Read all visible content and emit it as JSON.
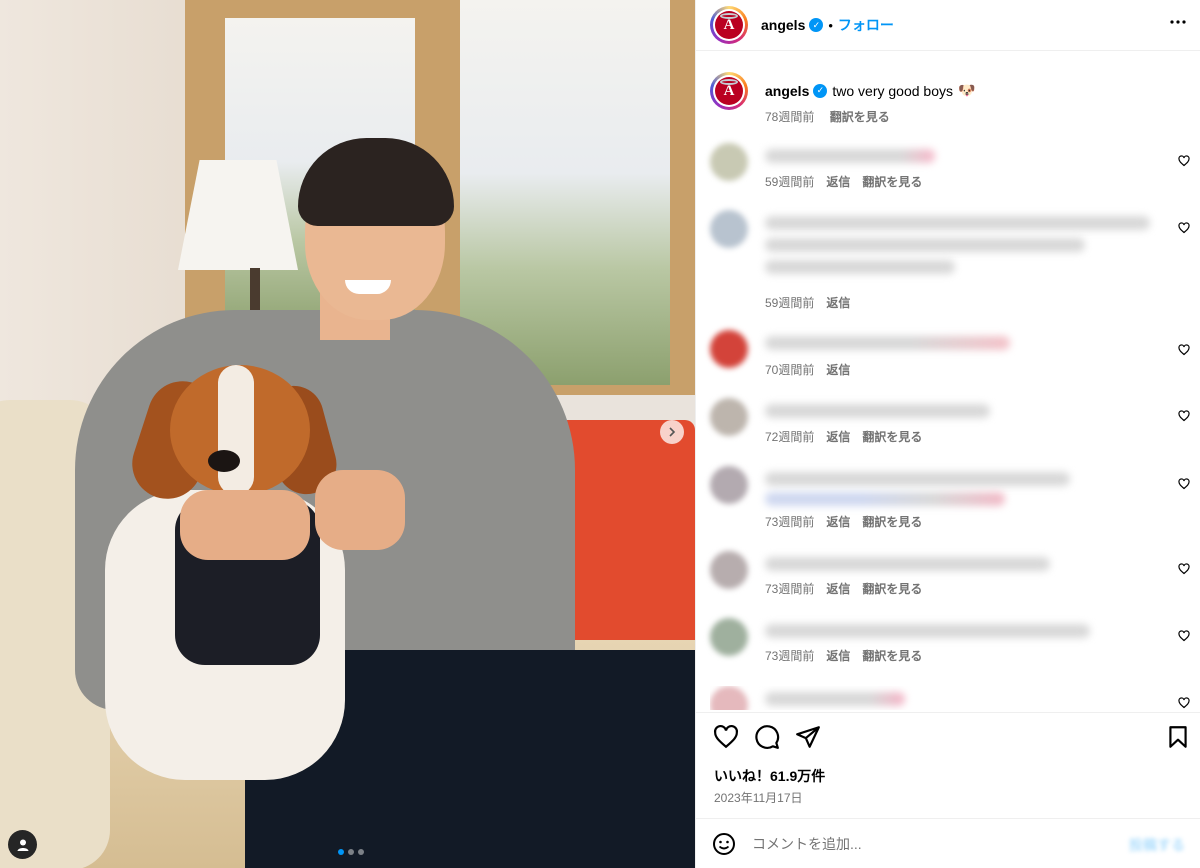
{
  "post": {
    "username": "angels",
    "follow_label": "フォロー",
    "caption": "two very good boys",
    "caption_emoji": "🐶",
    "caption_time": "78週間前",
    "translate_label": "翻訳を見る",
    "likes": "いいね！61.9万件",
    "date": "2023年11月17日",
    "comment_placeholder": "コメントを追加...",
    "post_label": "投稿する"
  },
  "comments": [
    {
      "time": "59週間前",
      "reply": "返信",
      "translate": "翻訳を見る"
    },
    {
      "time": "59週間前",
      "reply": "返信"
    },
    {
      "time": "70週間前",
      "reply": "返信"
    },
    {
      "time": "72週間前",
      "reply": "返信",
      "translate": "翻訳を見る"
    },
    {
      "time": "73週間前",
      "reply": "返信",
      "translate": "翻訳を見る"
    },
    {
      "time": "73週間前",
      "reply": "返信",
      "translate": "翻訳を見る"
    },
    {
      "time": "73週間前",
      "reply": "返信",
      "translate": "翻訳を見る"
    }
  ],
  "icons": {
    "more": "more-options-icon",
    "like": "heart-icon",
    "comment": "comment-icon",
    "share": "send-icon",
    "save": "bookmark-icon",
    "emoji": "emoji-icon",
    "next": "chevron-right-icon",
    "tag": "user-tag-icon"
  },
  "colors": {
    "accent": "#0095f6",
    "secondary_text": "#737373",
    "divider": "#efefef",
    "angels_red": "#ba0021"
  }
}
